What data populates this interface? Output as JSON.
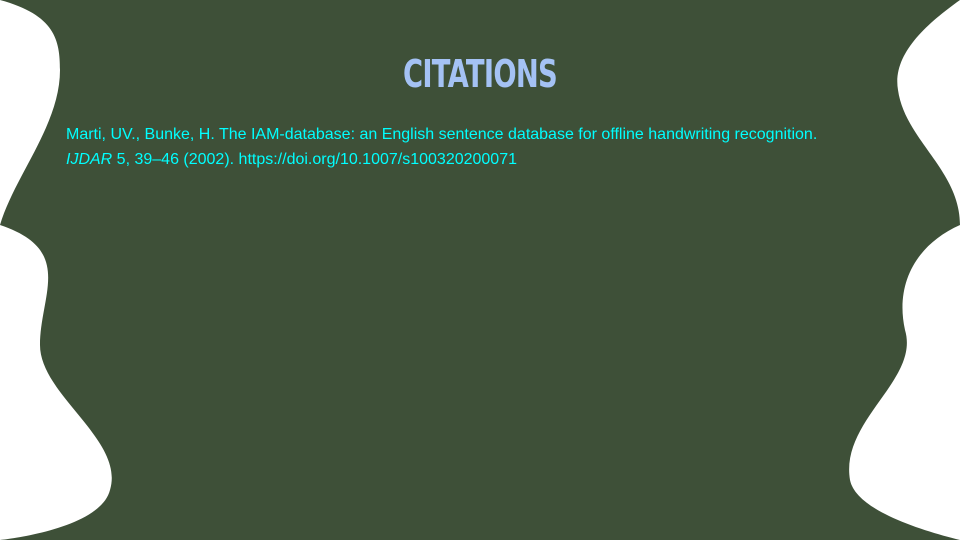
{
  "slide": {
    "title": "CITATIONS",
    "citation": {
      "line1": "Marti, UV., Bunke, H. The IAM-database: an English sentence database for offline handwriting recognition.",
      "journal": "IJDAR",
      "line2_rest": " 5, 39–46 (2002). https://doi.org/10.1007/s100320200071"
    }
  },
  "colors": {
    "background": "#3e5038",
    "title": "#a4c2f4",
    "text": "#00ffff",
    "edge_shapes": "#ffffff"
  }
}
